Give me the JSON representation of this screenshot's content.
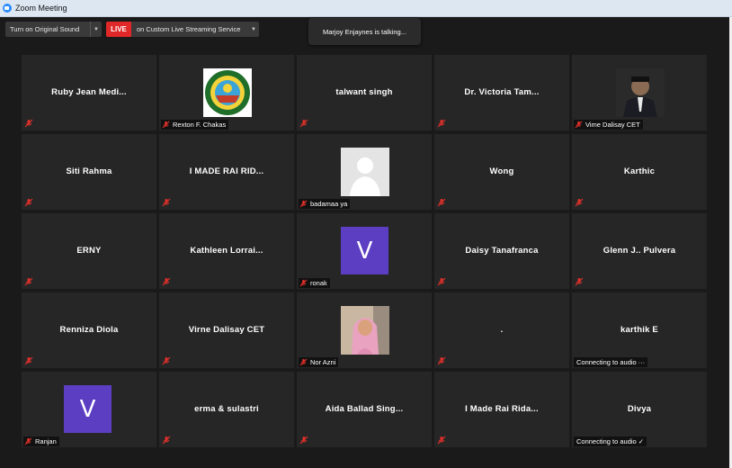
{
  "window": {
    "title": "Zoom Meeting"
  },
  "toolbar": {
    "sound_label": "Turn on Original Sound",
    "live_label": "LIVE",
    "stream_label": "on Custom Live Streaming Service"
  },
  "talking_indicator": "Marjoy Enjaynes is talking...",
  "colors": {
    "tile_bg": "#262626",
    "live_red": "#e02828",
    "avatar_purple": "#5b3ec2",
    "mute_red": "#e0302a"
  },
  "tiles": [
    {
      "name": "Ruby Jean  Medi..."
    },
    {
      "name": "Rexton F. Chakas"
    },
    {
      "name": "talwant singh"
    },
    {
      "name": "Dr. Victoria Tam..."
    },
    {
      "name": "Vime Dalisay CET"
    },
    {
      "name": "Siti Rahma"
    },
    {
      "name": "I MADE RAI RID..."
    },
    {
      "name": "badamaa ya"
    },
    {
      "name": "Wong"
    },
    {
      "name": "Karthic"
    },
    {
      "name": "ERNY"
    },
    {
      "name": "Kathleen  Lorrai..."
    },
    {
      "name": "ronak",
      "avatar_letter": "V"
    },
    {
      "name": "Daisy Tanafranca"
    },
    {
      "name": "Glenn J.. Pulvera"
    },
    {
      "name": "Renniza Diola"
    },
    {
      "name": "Virne Dalisay CET"
    },
    {
      "name": "Nor Azni"
    },
    {
      "name": "."
    },
    {
      "name": "karthik E",
      "status": "Connecting to audio ···"
    },
    {
      "name": "Ranjan",
      "avatar_letter": "V"
    },
    {
      "name": "erma & sulastri"
    },
    {
      "name": "Aida Ballad Sing..."
    },
    {
      "name": "I Made Rai Rida..."
    },
    {
      "name": "Divya",
      "status": "Connecting to audio ✓"
    }
  ]
}
